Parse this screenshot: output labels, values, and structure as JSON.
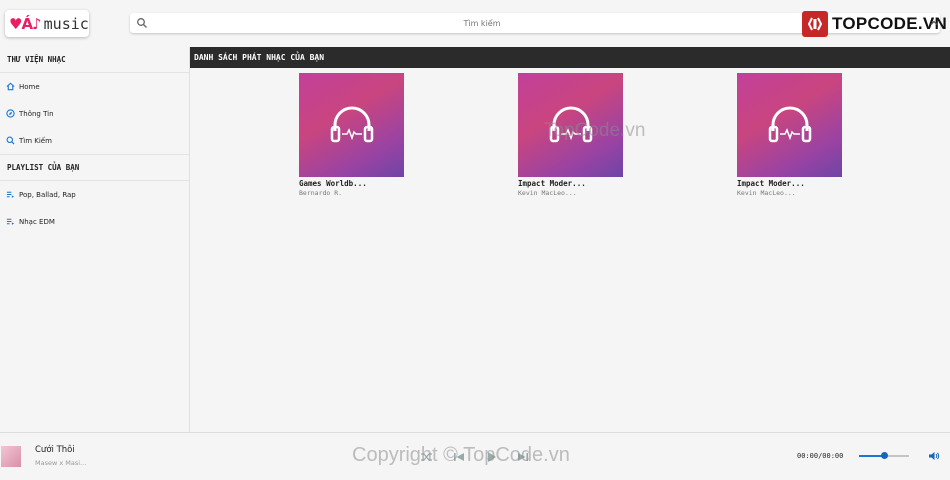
{
  "header": {
    "logo_mark": "♥Á♪",
    "logo_name": "music",
    "search_placeholder": "Tìm kiếm",
    "brand_text": "TOPCODE.VN"
  },
  "sidebar": {
    "library_title": "THƯ VIỆN NHẠC",
    "library_items": [
      {
        "label": "Home",
        "icon": "home-icon"
      },
      {
        "label": "Thông Tin",
        "icon": "compass-icon"
      },
      {
        "label": "Tìm Kiếm",
        "icon": "search-icon"
      }
    ],
    "playlist_title": "PLAYLIST CỦA BẠN",
    "playlist_items": [
      {
        "label": "Pop, Ballad, Rap",
        "icon": "playlist-icon"
      },
      {
        "label": "Nhạc EDM",
        "icon": "playlist-icon"
      }
    ]
  },
  "main": {
    "section_title": "DANH SÁCH PHÁT NHẠC CỦA BẠN",
    "cards": [
      {
        "title": "Games Worldb...",
        "artist": "Bernardo R."
      },
      {
        "title": "Impact Moder...",
        "artist": "Kevin MacLeo..."
      },
      {
        "title": "Impact Moder...",
        "artist": "Kevin MacLeo..."
      }
    ]
  },
  "player": {
    "title": "Cưới Thôi",
    "artist": "Masew x Masi...",
    "time": "00:00/00:00",
    "volume": 0.5
  },
  "watermarks": {
    "center": "TopCode.vn",
    "bottom": "Copyright © TopCode.vn"
  },
  "colors": {
    "accent": "#1976d2",
    "header_bar": "#2b2b2b",
    "brand_red": "#c62828",
    "cover_pink": "#c2409a"
  }
}
